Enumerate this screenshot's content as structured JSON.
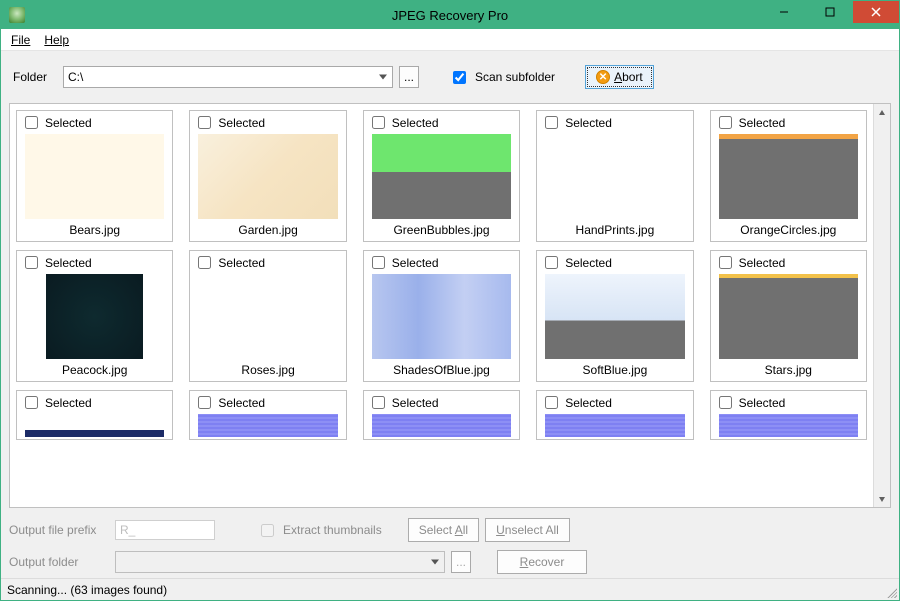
{
  "title": "JPEG Recovery Pro",
  "menu": {
    "file": "File",
    "help": "Help"
  },
  "toolbar": {
    "folder_label": "Folder",
    "folder_value": "C:\\",
    "browse": "...",
    "scan_subfolder_label": "Scan subfolder",
    "scan_subfolder_checked": true,
    "abort_label": "Abort"
  },
  "grid": {
    "selected_label": "Selected",
    "files": [
      {
        "name": "Bears.jpg",
        "thumb": "bears"
      },
      {
        "name": "Garden.jpg",
        "thumb": "garden"
      },
      {
        "name": "GreenBubbles.jpg",
        "thumb": "greenbubbles"
      },
      {
        "name": "HandPrints.jpg",
        "thumb": "handprints"
      },
      {
        "name": "OrangeCircles.jpg",
        "thumb": "orangecircles"
      },
      {
        "name": "Peacock.jpg",
        "thumb": "peacock"
      },
      {
        "name": "Roses.jpg",
        "thumb": "roses"
      },
      {
        "name": "ShadesOfBlue.jpg",
        "thumb": "shadesofblue"
      },
      {
        "name": "SoftBlue.jpg",
        "thumb": "softblue"
      },
      {
        "name": "Stars.jpg",
        "thumb": "stars"
      },
      {
        "name": "",
        "thumb": "purple1"
      },
      {
        "name": "",
        "thumb": "purple2"
      },
      {
        "name": "",
        "thumb": "purple3"
      },
      {
        "name": "",
        "thumb": "purple4"
      },
      {
        "name": "",
        "thumb": "purple5"
      }
    ]
  },
  "bottom": {
    "prefix_label": "Output file prefix",
    "prefix_value": "R_",
    "extract_thumbs_label": "Extract thumbnails",
    "select_all": "Select All",
    "unselect_all": "Unselect All",
    "output_folder_label": "Output folder",
    "recover": "Recover"
  },
  "status": "Scanning... (63 images found)"
}
